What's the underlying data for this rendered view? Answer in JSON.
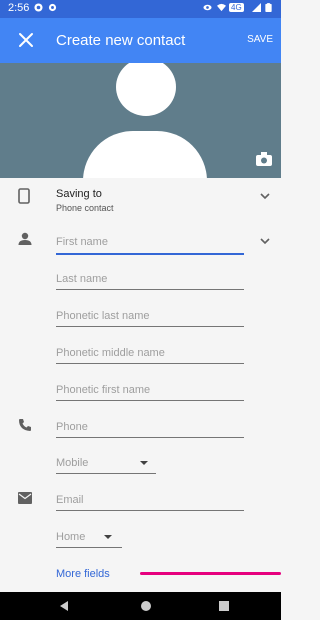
{
  "status_bar": {
    "time": "2:56",
    "icons": [
      "notification-icon",
      "settings-icon",
      "eye-icon",
      "wifi-icon",
      "network-icon",
      "signal-icon",
      "battery-icon"
    ],
    "network": "4G"
  },
  "header": {
    "title": "Create new contact",
    "save_label": "SAVE",
    "background": "#4285f4",
    "status_background": "#3367d6"
  },
  "photo": {
    "background": "#607d8b"
  },
  "account": {
    "label": "Saving to",
    "value": "Phone contact"
  },
  "name_fields": {
    "first_name": "First name",
    "last_name": "Last name",
    "phonetic_last": "Phonetic last name",
    "phonetic_middle": "Phonetic middle name",
    "phonetic_first": "Phonetic first name"
  },
  "phone": {
    "placeholder": "Phone",
    "type": "Mobile"
  },
  "email": {
    "placeholder": "Email",
    "type": "Home"
  },
  "more_fields": "More fields",
  "colors": {
    "accent": "#3367d6",
    "highlight_line": "#e6007e"
  }
}
